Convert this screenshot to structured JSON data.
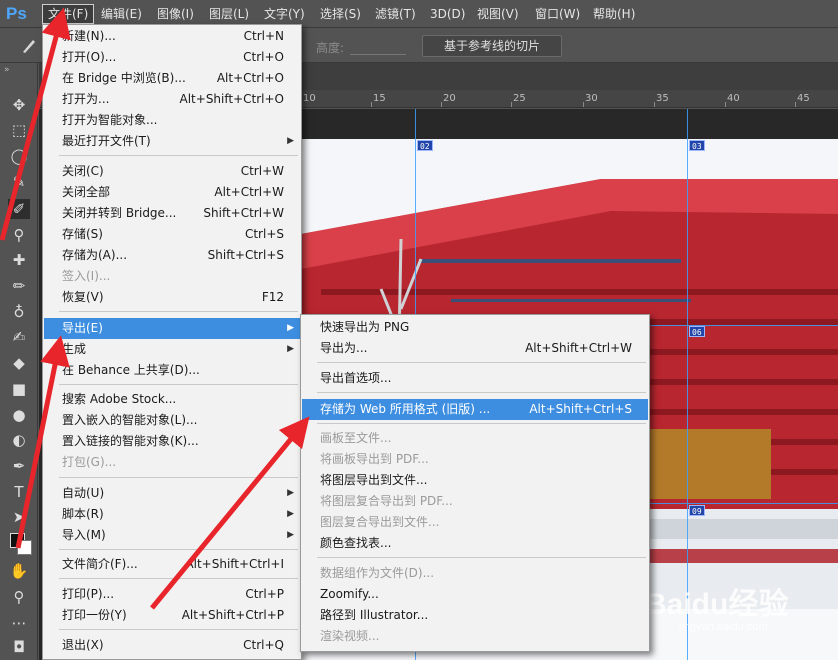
{
  "app": {
    "logo": "Ps"
  },
  "menubar": [
    {
      "label": "文件(F)",
      "active": true
    },
    {
      "label": "编辑(E)"
    },
    {
      "label": "图像(I)"
    },
    {
      "label": "图层(L)"
    },
    {
      "label": "文字(Y)"
    },
    {
      "label": "选择(S)"
    },
    {
      "label": "滤镜(T)"
    },
    {
      "label": "3D(D)"
    },
    {
      "label": "视图(V)"
    },
    {
      "label": "窗口(W)"
    },
    {
      "label": "帮助(H)"
    }
  ],
  "options_bar": {
    "height_label": "高度:",
    "slice_button_label": "基于参考线的切片"
  },
  "ruler": {
    "marks": [
      "10",
      "15",
      "20",
      "25",
      "30",
      "35",
      "40",
      "45"
    ]
  },
  "slices": {
    "s02": "02",
    "s03": "03",
    "s06": "06",
    "s09": "09"
  },
  "watermark": {
    "brand": "Baidu经验",
    "url": "jingyan.baidu.com"
  },
  "file_menu": {
    "items": [
      {
        "label": "新建(N)...",
        "shortcut": "Ctrl+N"
      },
      {
        "label": "打开(O)...",
        "shortcut": "Ctrl+O"
      },
      {
        "label": "在 Bridge 中浏览(B)...",
        "shortcut": "Alt+Ctrl+O"
      },
      {
        "label": "打开为...",
        "shortcut": "Alt+Shift+Ctrl+O"
      },
      {
        "label": "打开为智能对象..."
      },
      {
        "label": "最近打开文件(T)",
        "submenu": true
      },
      {
        "label": "关闭(C)",
        "shortcut": "Ctrl+W"
      },
      {
        "label": "关闭全部",
        "shortcut": "Alt+Ctrl+W"
      },
      {
        "label": "关闭并转到 Bridge...",
        "shortcut": "Shift+Ctrl+W"
      },
      {
        "label": "存储(S)",
        "shortcut": "Ctrl+S"
      },
      {
        "label": "存储为(A)...",
        "shortcut": "Shift+Ctrl+S"
      },
      {
        "label": "签入(I)...",
        "disabled": true
      },
      {
        "label": "恢复(V)",
        "shortcut": "F12"
      },
      {
        "label": "导出(E)",
        "submenu": true,
        "highlighted": true
      },
      {
        "label": "生成",
        "submenu": true
      },
      {
        "label": "在 Behance 上共享(D)..."
      },
      {
        "label": "搜索 Adobe Stock..."
      },
      {
        "label": "置入嵌入的智能对象(L)..."
      },
      {
        "label": "置入链接的智能对象(K)..."
      },
      {
        "label": "打包(G)...",
        "disabled": true
      },
      {
        "label": "自动(U)",
        "submenu": true
      },
      {
        "label": "脚本(R)",
        "submenu": true
      },
      {
        "label": "导入(M)",
        "submenu": true
      },
      {
        "label": "文件简介(F)...",
        "shortcut": "Alt+Shift+Ctrl+I"
      },
      {
        "label": "打印(P)...",
        "shortcut": "Ctrl+P"
      },
      {
        "label": "打印一份(Y)",
        "shortcut": "Alt+Shift+Ctrl+P"
      },
      {
        "label": "退出(X)",
        "shortcut": "Ctrl+Q"
      }
    ]
  },
  "export_menu": {
    "items": [
      {
        "label": "快速导出为 PNG"
      },
      {
        "label": "导出为...",
        "shortcut": "Alt+Shift+Ctrl+W"
      },
      {
        "label": "导出首选项..."
      },
      {
        "label": "存储为 Web 所用格式 (旧版) ...",
        "shortcut": "Alt+Shift+Ctrl+S",
        "highlighted": true
      },
      {
        "label": "画板至文件...",
        "disabled": true
      },
      {
        "label": "将画板导出到 PDF...",
        "disabled": true
      },
      {
        "label": "将图层导出到文件..."
      },
      {
        "label": "将图层复合导出到 PDF...",
        "disabled": true
      },
      {
        "label": "图层复合导出到文件...",
        "disabled": true
      },
      {
        "label": "颜色查找表..."
      },
      {
        "label": "数据组作为文件(D)...",
        "disabled": true
      },
      {
        "label": "Zoomify..."
      },
      {
        "label": "路径到 Illustrator..."
      },
      {
        "label": "渲染视频...",
        "disabled": true
      }
    ]
  },
  "colors": {
    "menu_highlight": "#3d8ee0",
    "annotation_arrow": "#e8252b",
    "building_red": "#c8323a"
  }
}
